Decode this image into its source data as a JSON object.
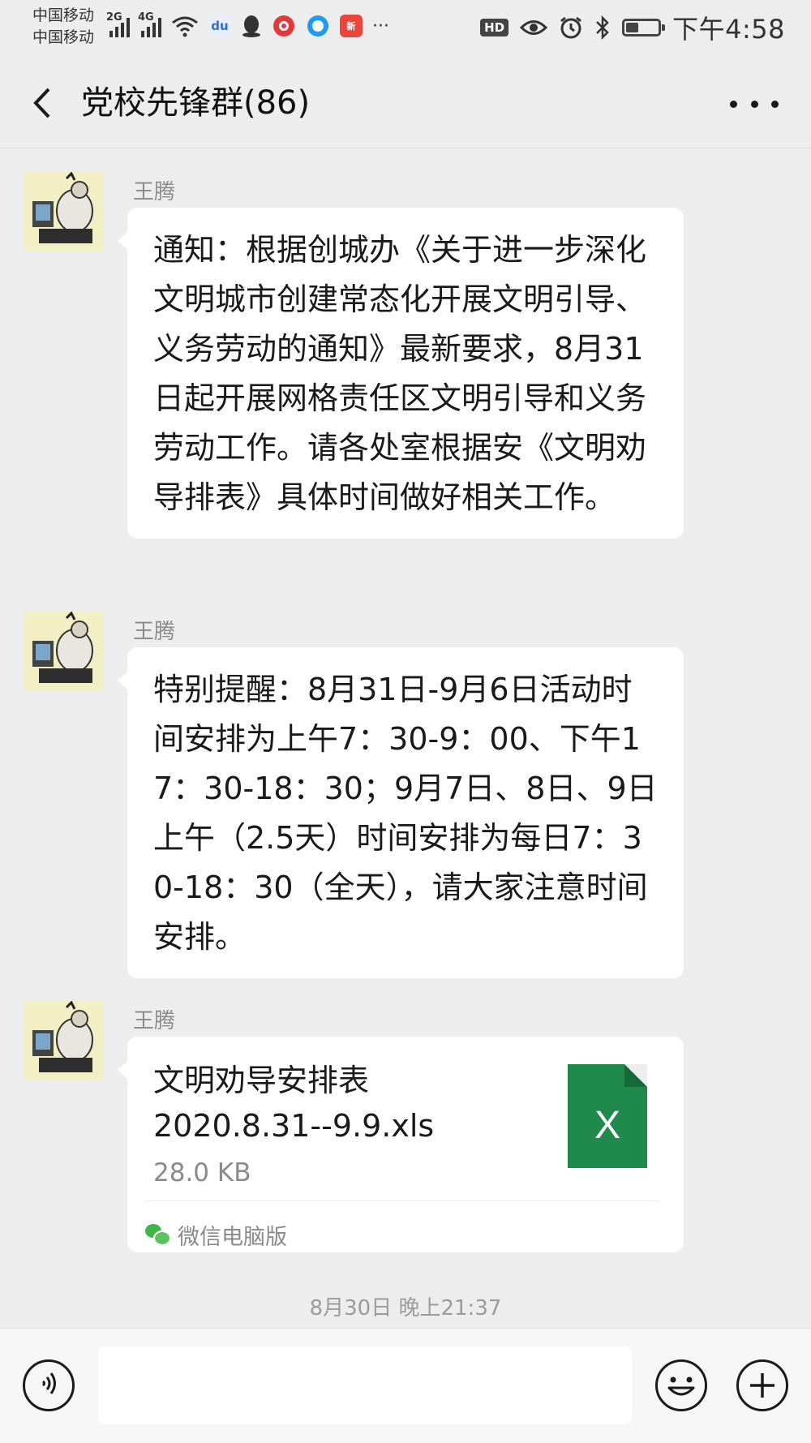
{
  "status_bar": {
    "carrier_1": "中国移动",
    "carrier_2": "中国移动",
    "network_1": "2G",
    "network_2": "4G",
    "hd_label": "HD",
    "more_notifications": "···",
    "time": "下午4:58",
    "battery_level": 0.4
  },
  "nav": {
    "title": "党校先锋群(86)"
  },
  "messages": [
    {
      "sender": "王腾",
      "type": "text",
      "text": "通知：根据创城办《关于进一步深化文明城市创建常态化开展文明引导、义务劳动的通知》最新要求，8月31日起开展网格责任区文明引导和义务劳动工作。请各处室根据安《文明劝导排表》具体时间做好相关工作。"
    },
    {
      "sender": "王腾",
      "type": "text",
      "text": "特别提醒：8月31日-9月6日活动时间安排为上午7：30-9：00、下午17：30-18：30；9月7日、8日、9日上午（2.5天）时间安排为每日7：30-18：30（全天），请大家注意时间安排。"
    },
    {
      "sender": "王腾",
      "type": "file",
      "file_name_line1": "文明劝导安排表",
      "file_name_line2": "2020.8.31--9.9.xls",
      "file_size": "28.0 KB",
      "file_icon_letter": "X",
      "source": "微信电脑版"
    }
  ],
  "timestamp": "8月30日 晚上21:37",
  "input_bar": {
    "input_value": ""
  },
  "colors": {
    "background": "#ededed",
    "bubble": "#ffffff",
    "excel_green": "#1f8a4c",
    "wechat_green": "#3fb54a"
  }
}
